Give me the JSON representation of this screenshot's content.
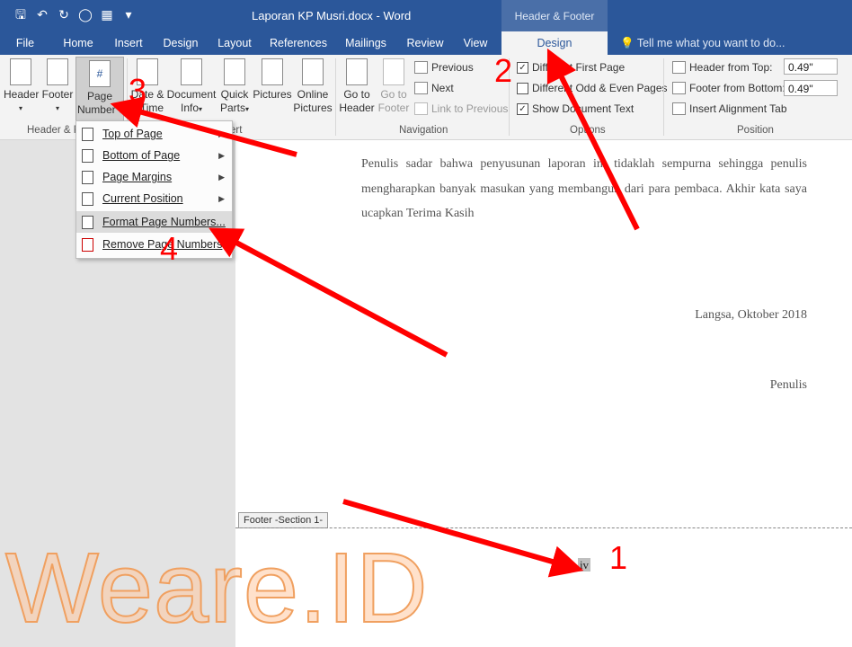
{
  "window": {
    "title": "Laporan KP Musri.docx - Word",
    "context_group": "Header & Footer Tools"
  },
  "tabs": [
    {
      "label": "File"
    },
    {
      "label": "Home"
    },
    {
      "label": "Insert"
    },
    {
      "label": "Design"
    },
    {
      "label": "Layout"
    },
    {
      "label": "References"
    },
    {
      "label": "Mailings"
    },
    {
      "label": "Review"
    },
    {
      "label": "View"
    },
    {
      "label": "Design",
      "active": true
    }
  ],
  "tell_me": "Tell me what you want to do...",
  "ribbon": {
    "header_btn": "Header",
    "footer_btn": "Footer",
    "page_number_1": "Page",
    "page_number_2": "Number",
    "date_1": "Date &",
    "date_2": "Time",
    "docinfo_1": "Document",
    "docinfo_2": "Info",
    "quickparts_1": "Quick",
    "quickparts_2": "Parts",
    "pictures": "Pictures",
    "online_1": "Online",
    "online_2": "Pictures",
    "goto_header_1": "Go to",
    "goto_header_2": "Header",
    "goto_footer_1": "Go to",
    "goto_footer_2": "Footer",
    "previous": "Previous",
    "next": "Next",
    "link_prev": "Link to Previous",
    "diff_first": "Different First Page",
    "diff_odd_even": "Different Odd & Even Pages",
    "show_doc_text": "Show Document Text",
    "header_from_top": "Header from Top:",
    "header_value": "0.49\"",
    "footer_from_bottom": "Footer from Bottom:",
    "footer_value": "0.49\"",
    "insert_align_tab": "Insert Alignment Tab",
    "group_hf": "Header & F",
    "group_insert": "ert",
    "group_nav": "Navigation",
    "group_options": "Options",
    "group_position": "Position"
  },
  "menu": [
    {
      "label": "Top of Page",
      "sub": true
    },
    {
      "label": "Bottom of Page",
      "sub": true
    },
    {
      "label": "Page Margins",
      "sub": true
    },
    {
      "label": "Current Position",
      "sub": true
    },
    {
      "label": "Format Page Numbers...",
      "sub": false,
      "highlight": true
    },
    {
      "label": "Remove Page Numbers",
      "sub": false
    }
  ],
  "document": {
    "body": "Penulis sadar bahwa penyusunan laporan ini tidaklah sempurna sehingga penulis mengharapkan banyak masukan yang membangun dari para pembaca. Akhir kata saya ucapkan Terima Kasih",
    "place_date": "Langsa, Oktober 2018",
    "signer": "Penulis",
    "footer_label": "Footer -Section 1-",
    "page_number": "iv"
  },
  "annotations": [
    "1",
    "2",
    "3",
    "4"
  ],
  "watermark": "Weare.ID",
  "colors": {
    "title_bar": "#2b579a",
    "arrow": "#ff0000",
    "watermark": "#f0a060"
  }
}
